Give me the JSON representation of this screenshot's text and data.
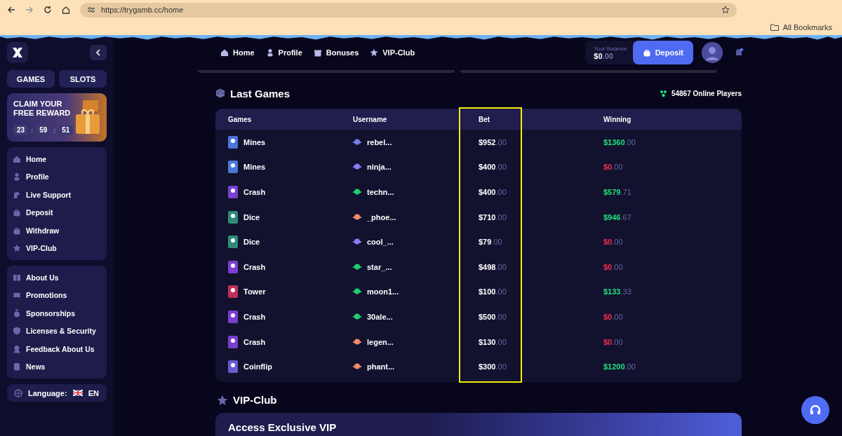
{
  "browser": {
    "url": "https://trygamb.cc/home",
    "bookmarks_label": "All Bookmarks"
  },
  "sidebar": {
    "tabs": [
      "GAMES",
      "SLOTS"
    ],
    "promo": {
      "title": "CLAIM YOUR FREE REWARD",
      "timer": [
        "23",
        "59",
        "51"
      ],
      "separator": ":"
    },
    "menu_groups": [
      [
        "Home",
        "Profile",
        "Live Support",
        "Deposit",
        "Withdraw",
        "VIP-Club"
      ],
      [
        "About Us",
        "Promotions",
        "Sponsorships",
        "Licenses & Security",
        "Feedback About Us",
        "News"
      ]
    ],
    "language": {
      "label": "Language:",
      "code": "EN"
    }
  },
  "header": {
    "nav": [
      "Home",
      "Profile",
      "Bonuses",
      "VIP-Club"
    ],
    "balance_label": "Your Balance",
    "balance": {
      "whole": "$0",
      "cents": ".00"
    },
    "deposit": "Deposit"
  },
  "last_games": {
    "title": "Last Games",
    "online": "54867 Online Players",
    "columns": [
      "Games",
      "Username",
      "Bet",
      "Winning"
    ],
    "rows": [
      {
        "game": {
          "name": "Mines",
          "color": "#4a78d8"
        },
        "user": {
          "name": "rebel...",
          "color": "#7b7bf0"
        },
        "bet": {
          "whole": "$952",
          "cents": ".00"
        },
        "winning": {
          "whole": "$1360",
          "cents": ".00",
          "color": "#1fe27a"
        }
      },
      {
        "game": {
          "name": "Mines",
          "color": "#4a78d8"
        },
        "user": {
          "name": "ninja...",
          "color": "#8a7cf5"
        },
        "bet": {
          "whole": "$400",
          "cents": ".00"
        },
        "winning": {
          "whole": "$0",
          "cents": ".00",
          "color": "#f0304e"
        }
      },
      {
        "game": {
          "name": "Crash",
          "color": "#7a3fd0"
        },
        "user": {
          "name": "techn...",
          "color": "#1fce6c"
        },
        "bet": {
          "whole": "$400",
          "cents": ".00"
        },
        "winning": {
          "whole": "$579",
          "cents": ".71",
          "color": "#1fe27a"
        }
      },
      {
        "game": {
          "name": "Dice",
          "color": "#2d8a7a"
        },
        "user": {
          "name": "_phoe...",
          "color": "#f08a6a"
        },
        "bet": {
          "whole": "$710",
          "cents": ".00"
        },
        "winning": {
          "whole": "$946",
          "cents": ".67",
          "color": "#1fe27a"
        }
      },
      {
        "game": {
          "name": "Dice",
          "color": "#2d8a7a"
        },
        "user": {
          "name": "cool_...",
          "color": "#8a7cf5"
        },
        "bet": {
          "whole": "$79",
          "cents": ".00"
        },
        "winning": {
          "whole": "$0",
          "cents": ".00",
          "color": "#f0304e"
        }
      },
      {
        "game": {
          "name": "Crash",
          "color": "#7a3fd0"
        },
        "user": {
          "name": "star_...",
          "color": "#1fce6c"
        },
        "bet": {
          "whole": "$498",
          "cents": ".00"
        },
        "winning": {
          "whole": "$0",
          "cents": ".00",
          "color": "#f0304e"
        }
      },
      {
        "game": {
          "name": "Tower",
          "color": "#c0305a"
        },
        "user": {
          "name": "moon1...",
          "color": "#1fce6c"
        },
        "bet": {
          "whole": "$100",
          "cents": ".00"
        },
        "winning": {
          "whole": "$133",
          "cents": ".33",
          "color": "#1fe27a"
        }
      },
      {
        "game": {
          "name": "Crash",
          "color": "#7a3fd0"
        },
        "user": {
          "name": "30ale...",
          "color": "#1fce6c"
        },
        "bet": {
          "whole": "$500",
          "cents": ".00"
        },
        "winning": {
          "whole": "$0",
          "cents": ".00",
          "color": "#f0304e"
        }
      },
      {
        "game": {
          "name": "Crash",
          "color": "#7a3fd0"
        },
        "user": {
          "name": "legen...",
          "color": "#f08a6a"
        },
        "bet": {
          "whole": "$130",
          "cents": ".00"
        },
        "winning": {
          "whole": "$0",
          "cents": ".00",
          "color": "#f0304e"
        }
      },
      {
        "game": {
          "name": "Coinflip",
          "color": "#6a5ad0"
        },
        "user": {
          "name": "phant...",
          "color": "#f08a6a"
        },
        "bet": {
          "whole": "$300",
          "cents": ".00"
        },
        "winning": {
          "whole": "$1200",
          "cents": ".00",
          "color": "#1fe27a"
        }
      }
    ]
  },
  "vip": {
    "title": "VIP-Club",
    "banner_title": "Access Exclusive VIP"
  }
}
